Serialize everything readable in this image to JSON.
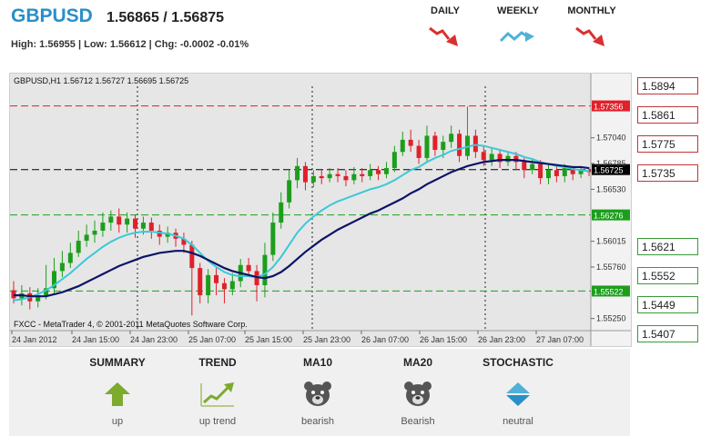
{
  "header": {
    "pair": "GBPUSD",
    "quote": "1.56865 / 1.56875",
    "stats": "High: 1.56955 | Low: 1.56612 | Chg: -0.0002 -0.01%"
  },
  "timeframes": [
    {
      "label": "DAILY",
      "icon": "down-trend-arrow-icon",
      "color": "#d93030"
    },
    {
      "label": "WEEKLY",
      "icon": "sideways-trend-arrow-icon",
      "color": "#4fb1d9"
    },
    {
      "label": "MONTHLY",
      "icon": "down-trend-arrow-icon",
      "color": "#d93030"
    }
  ],
  "levels": {
    "resistance": [
      "1.5894",
      "1.5861",
      "1.5775",
      "1.5735"
    ],
    "support": [
      "1.5621",
      "1.5552",
      "1.5449",
      "1.5407"
    ]
  },
  "indicators": [
    {
      "title": "SUMMARY",
      "value": "up",
      "icon": "up-arrow-icon"
    },
    {
      "title": "TREND",
      "value": "up trend",
      "icon": "trend-up-icon"
    },
    {
      "title": "MA10",
      "value": "bearish",
      "icon": "bear-icon"
    },
    {
      "title": "MA20",
      "value": "Bearish",
      "icon": "bear-icon"
    },
    {
      "title": "STOCHASTIC",
      "value": "neutral",
      "icon": "neutral-diamond-icon"
    }
  ],
  "colors": {
    "brand": "#2a8fc7",
    "bull": "#1c9e1c",
    "bear": "#e0202a",
    "ma_fast": "#3cc8d8",
    "ma_slow": "#0c1466"
  },
  "chart_data": {
    "type": "candlestick",
    "header": "GBPUSD,H1  1.56712 1.56727 1.56695 1.56725",
    "footer": "FXCC - MetaTrader 4, © 2001-2011 MetaQuotes Software Corp.",
    "ylim": [
      1.5513,
      1.5755
    ],
    "y_ticks": [
      "1.57040",
      "1.56785",
      "1.56530",
      "1.56015",
      "1.55760",
      "1.55250"
    ],
    "x_ticks": [
      "24 Jan 2012",
      "24 Jan 15:00",
      "24 Jan 23:00",
      "25 Jan 07:00",
      "25 Jan 15:00",
      "25 Jan 23:00",
      "26 Jan 07:00",
      "26 Jan 15:00",
      "26 Jan 23:00",
      "27 Jan 07:00"
    ],
    "hlines": [
      {
        "value": 1.57356,
        "label": "1.57356",
        "color": "#e0202a"
      },
      {
        "value": 1.56725,
        "label": "1.56725",
        "color": "#000000"
      },
      {
        "value": 1.56276,
        "label": "1.56276",
        "color": "#1c9e1c"
      },
      {
        "value": 1.55522,
        "label": "1.55522",
        "color": "#1c9e1c"
      }
    ],
    "candles": [
      [
        1.5553,
        1.5545,
        1.5562,
        1.554
      ],
      [
        1.5545,
        1.555,
        1.5558,
        1.5538
      ],
      [
        1.555,
        1.5542,
        1.5556,
        1.5534
      ],
      [
        1.5542,
        1.5548,
        1.5555,
        1.5536
      ],
      [
        1.5548,
        1.5555,
        1.5578,
        1.5544
      ],
      [
        1.5555,
        1.5572,
        1.5585,
        1.555
      ],
      [
        1.5572,
        1.558,
        1.5592,
        1.5566
      ],
      [
        1.558,
        1.559,
        1.56,
        1.5575
      ],
      [
        1.559,
        1.5602,
        1.5612,
        1.5586
      ],
      [
        1.5602,
        1.5608,
        1.5618,
        1.5596
      ],
      [
        1.5608,
        1.5612,
        1.5622,
        1.56
      ],
      [
        1.5612,
        1.562,
        1.563,
        1.5606
      ],
      [
        1.562,
        1.5626,
        1.5632,
        1.5612
      ],
      [
        1.5626,
        1.5618,
        1.5634,
        1.561
      ],
      [
        1.5618,
        1.5624,
        1.563,
        1.561
      ],
      [
        1.5624,
        1.5614,
        1.5628,
        1.5605
      ],
      [
        1.5614,
        1.562,
        1.5626,
        1.5608
      ],
      [
        1.562,
        1.5612,
        1.5625,
        1.5604
      ],
      [
        1.5612,
        1.5606,
        1.5618,
        1.5598
      ],
      [
        1.5606,
        1.561,
        1.5616,
        1.56
      ],
      [
        1.561,
        1.5604,
        1.5614,
        1.5596
      ],
      [
        1.5604,
        1.5598,
        1.561,
        1.559
      ],
      [
        1.5598,
        1.5575,
        1.5602,
        1.5528
      ],
      [
        1.5575,
        1.5548,
        1.558,
        1.554
      ],
      [
        1.5548,
        1.5568,
        1.5574,
        1.554
      ],
      [
        1.5568,
        1.556,
        1.5575,
        1.5548
      ],
      [
        1.556,
        1.5554,
        1.5565,
        1.554
      ],
      [
        1.5554,
        1.5562,
        1.557,
        1.5548
      ],
      [
        1.5562,
        1.5578,
        1.5584,
        1.5556
      ],
      [
        1.5578,
        1.5572,
        1.5585,
        1.5566
      ],
      [
        1.5572,
        1.5558,
        1.5578,
        1.5542
      ],
      [
        1.5558,
        1.5588,
        1.56,
        1.5546
      ],
      [
        1.5588,
        1.562,
        1.563,
        1.5582
      ],
      [
        1.562,
        1.564,
        1.565,
        1.5614
      ],
      [
        1.564,
        1.5662,
        1.5672,
        1.5634
      ],
      [
        1.5662,
        1.5676,
        1.5684,
        1.5654
      ],
      [
        1.5676,
        1.566,
        1.568,
        1.5652
      ],
      [
        1.566,
        1.5666,
        1.5672,
        1.5655
      ],
      [
        1.5666,
        1.5664,
        1.5672,
        1.5658
      ],
      [
        1.5664,
        1.5668,
        1.5674,
        1.566
      ],
      [
        1.5668,
        1.5666,
        1.5674,
        1.566
      ],
      [
        1.5666,
        1.5662,
        1.5672,
        1.5656
      ],
      [
        1.5662,
        1.5668,
        1.5675,
        1.5658
      ],
      [
        1.5668,
        1.5666,
        1.5674,
        1.566
      ],
      [
        1.5666,
        1.5672,
        1.5678,
        1.5662
      ],
      [
        1.5672,
        1.5668,
        1.5676,
        1.5662
      ],
      [
        1.5668,
        1.5674,
        1.568,
        1.5664
      ],
      [
        1.5674,
        1.569,
        1.5696,
        1.567
      ],
      [
        1.569,
        1.5702,
        1.571,
        1.5686
      ],
      [
        1.5702,
        1.5696,
        1.5712,
        1.569
      ],
      [
        1.5696,
        1.5684,
        1.5702,
        1.5678
      ],
      [
        1.5684,
        1.5706,
        1.5716,
        1.568
      ],
      [
        1.5706,
        1.5692,
        1.571,
        1.5686
      ],
      [
        1.5692,
        1.57,
        1.5706,
        1.5684
      ],
      [
        1.57,
        1.5708,
        1.5716,
        1.5694
      ],
      [
        1.5708,
        1.5686,
        1.5712,
        1.568
      ],
      [
        1.5686,
        1.5706,
        1.5735,
        1.5682
      ],
      [
        1.5706,
        1.569,
        1.5712,
        1.5684
      ],
      [
        1.569,
        1.5682,
        1.5696,
        1.5676
      ],
      [
        1.5682,
        1.5688,
        1.5694,
        1.5676
      ],
      [
        1.5688,
        1.568,
        1.5692,
        1.5674
      ],
      [
        1.568,
        1.5686,
        1.569,
        1.5676
      ],
      [
        1.5686,
        1.568,
        1.569,
        1.5672
      ],
      [
        1.568,
        1.5672,
        1.5684,
        1.5664
      ],
      [
        1.5672,
        1.5678,
        1.5684,
        1.5668
      ],
      [
        1.5678,
        1.5664,
        1.5682,
        1.5658
      ],
      [
        1.5664,
        1.5672,
        1.5678,
        1.5658
      ],
      [
        1.5672,
        1.5666,
        1.5676,
        1.566
      ],
      [
        1.5666,
        1.5674,
        1.5678,
        1.566
      ],
      [
        1.5674,
        1.5668,
        1.5676,
        1.5662
      ],
      [
        1.5668,
        1.5672,
        1.5676,
        1.5664
      ],
      [
        1.5672,
        1.567,
        1.5675,
        1.5666
      ]
    ],
    "series": [
      {
        "color": "#3cc8d8",
        "values": [
          1.5543,
          1.5544,
          1.5546,
          1.5549,
          1.5553,
          1.5558,
          1.5564,
          1.557,
          1.5577,
          1.5584,
          1.559,
          1.5596,
          1.5601,
          1.5605,
          1.5608,
          1.561,
          1.5611,
          1.5611,
          1.561,
          1.5609,
          1.5607,
          1.5604,
          1.5598,
          1.559,
          1.5582,
          1.5576,
          1.5571,
          1.5568,
          1.5567,
          1.5567,
          1.5566,
          1.5569,
          1.5576,
          1.5586,
          1.5598,
          1.561,
          1.5619,
          1.5626,
          1.5632,
          1.5637,
          1.5641,
          1.5644,
          1.5647,
          1.565,
          1.5653,
          1.5655,
          1.5658,
          1.5662,
          1.5667,
          1.5672,
          1.5675,
          1.568,
          1.5684,
          1.5687,
          1.5691,
          1.5693,
          1.5695,
          1.5697,
          1.5696,
          1.5694,
          1.5692,
          1.569,
          1.5688,
          1.5685,
          1.5683,
          1.568,
          1.5678,
          1.5676,
          1.5675,
          1.5673,
          1.5672,
          1.5671
        ]
      },
      {
        "color": "#0c1466",
        "values": [
          1.5548,
          1.5548,
          1.5547,
          1.5547,
          1.5547,
          1.5549,
          1.5551,
          1.5554,
          1.5557,
          1.5561,
          1.5565,
          1.5569,
          1.5573,
          1.5577,
          1.558,
          1.5583,
          1.5586,
          1.5588,
          1.559,
          1.5591,
          1.5592,
          1.5592,
          1.559,
          1.5587,
          1.5583,
          1.5579,
          1.5575,
          1.5572,
          1.557,
          1.5568,
          1.5566,
          1.5565,
          1.5567,
          1.5571,
          1.5577,
          1.5584,
          1.5591,
          1.5597,
          1.5603,
          1.5608,
          1.5613,
          1.5617,
          1.5621,
          1.5625,
          1.5629,
          1.5632,
          1.5636,
          1.564,
          1.5644,
          1.5649,
          1.5653,
          1.5658,
          1.5662,
          1.5666,
          1.567,
          1.5673,
          1.5676,
          1.5678,
          1.568,
          1.5681,
          1.5682,
          1.5682,
          1.5682,
          1.5681,
          1.568,
          1.5679,
          1.5678,
          1.5677,
          1.5676,
          1.5675,
          1.5675,
          1.5674
        ]
      }
    ]
  }
}
